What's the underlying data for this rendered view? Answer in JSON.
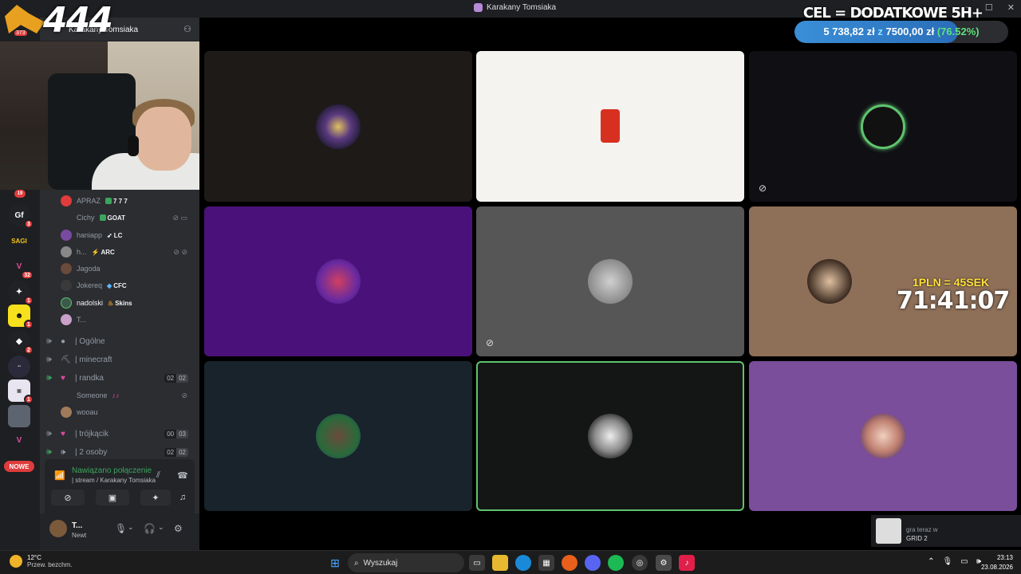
{
  "window": {
    "title": "Karakany Tomsiaka"
  },
  "overlay": {
    "logo_number": "444",
    "logo_count": "373",
    "goal_title": "CEL = DODATKOWE 5H+",
    "goal_current": "5 738,82 zł",
    "goal_sep": "z",
    "goal_target": "7500,00 zł",
    "goal_percent": "(76.52%)",
    "goal_fraction": 0.7652,
    "timer_label": "1PLN = 45SEK",
    "timer_value": "71:41:07"
  },
  "rail": {
    "badges": [
      "19",
      "3",
      "32",
      "1",
      "1",
      "2",
      "1"
    ],
    "new_label": "NOWE"
  },
  "server": {
    "name": "Karakany Tomsiaka"
  },
  "members": [
    {
      "name": "APRAZ",
      "tag": "7 7 7"
    },
    {
      "name": "Cichy",
      "tag": "GOAT"
    },
    {
      "name": "haniapp",
      "tag": "LC"
    },
    {
      "name": "h...",
      "tag": "ARC"
    },
    {
      "name": "Jagoda",
      "tag": ""
    },
    {
      "name": "Jokereq",
      "tag": "CFC"
    },
    {
      "name": "nadolski",
      "tag": "Skins"
    },
    {
      "name": "T...",
      "tag": ""
    }
  ],
  "channels": [
    {
      "name": "| Ogólne",
      "c1": "",
      "c2": ""
    },
    {
      "name": "| minecraft",
      "c1": "",
      "c2": ""
    },
    {
      "name": "| randka",
      "c1": "02",
      "c2": "02"
    },
    {
      "name": "| trójkącik",
      "c1": "00",
      "c2": "03"
    },
    {
      "name": "| 2 osoby",
      "c1": "02",
      "c2": "02"
    }
  ],
  "randka_members": [
    {
      "name": "Someone"
    },
    {
      "name": "wooau"
    }
  ],
  "voice": {
    "status": "Nawiązano połączenie",
    "location": "| stream / Karakany Tomsiaka"
  },
  "user": {
    "name": "T...",
    "status": "Newt"
  },
  "now_playing": {
    "line1": "gra teraz w",
    "line2": "GRID 2"
  },
  "taskbar": {
    "temp": "12°C",
    "weather": "Przew. bezchm.",
    "search": "Wyszukaj",
    "time": "23:13",
    "date": "23.08.2026"
  },
  "colors": {
    "accent": "#5865f2",
    "speaking": "#5fc36d",
    "danger": "#e03c3c"
  }
}
